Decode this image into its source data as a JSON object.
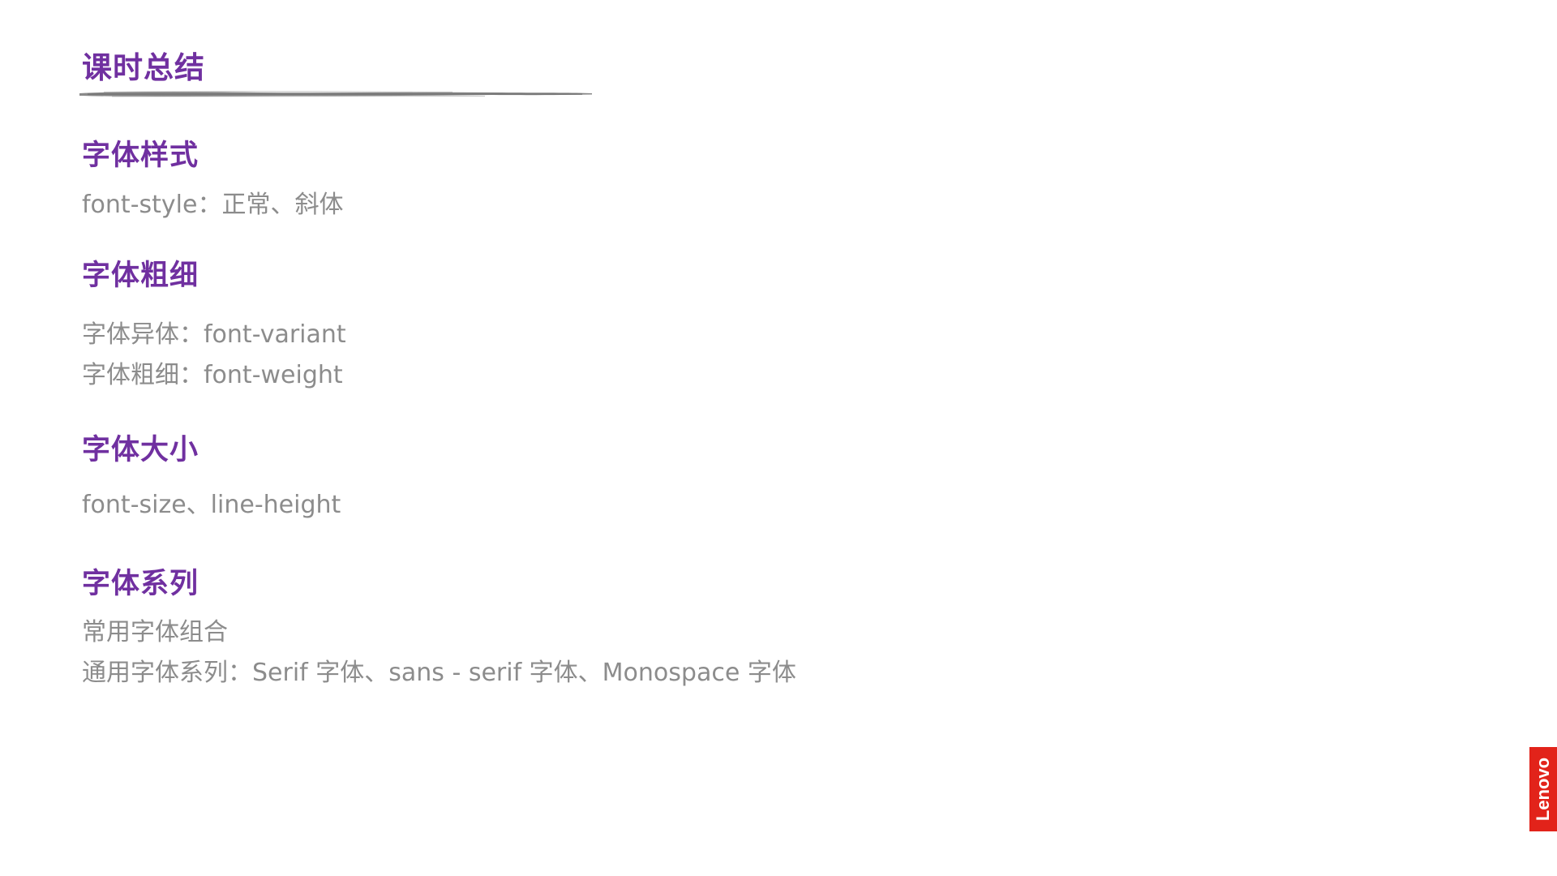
{
  "slide": {
    "title": "课时总结"
  },
  "sections": [
    {
      "heading": "字体样式",
      "lines": [
        "font-style：正常、斜体"
      ]
    },
    {
      "heading": "字体粗细",
      "lines": [
        "字体异体：font-variant",
        "字体粗细：font-weight"
      ]
    },
    {
      "heading": "字体大小",
      "lines": [
        "font-size、line-height"
      ]
    },
    {
      "heading": "字体系列",
      "lines": [
        "常用字体组合",
        "通用字体系列：Serif 字体、sans - serif 字体、Monospace 字体"
      ]
    }
  ],
  "branding": {
    "logo_text": "Lenovo",
    "logo_color": "#e2231a"
  },
  "colors": {
    "heading": "#7030a0",
    "body_text": "#8c8c8c",
    "brush_line": "#8a8a8a"
  }
}
